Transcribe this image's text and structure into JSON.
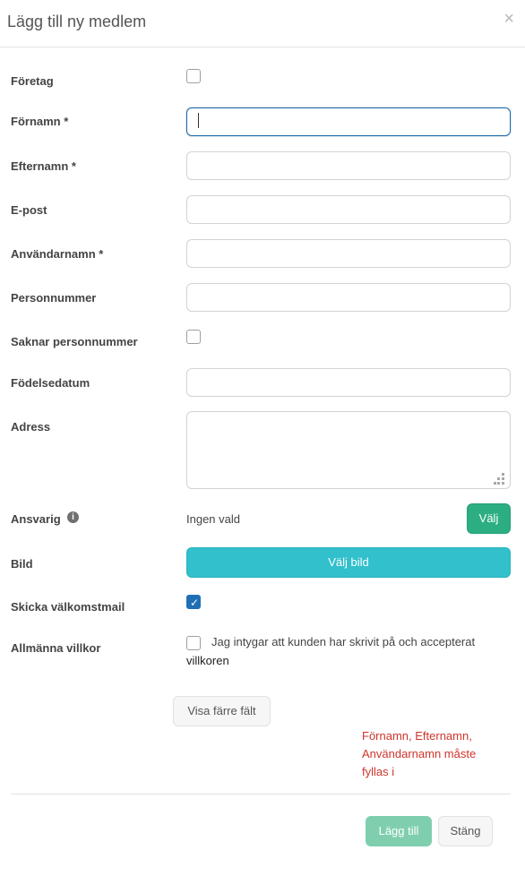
{
  "header": {
    "title": "Lägg till ny medlem",
    "close_glyph": "×"
  },
  "form": {
    "company": {
      "label": "Företag",
      "checked": false
    },
    "first_name": {
      "label": "Förnamn *",
      "value": ""
    },
    "last_name": {
      "label": "Efternamn *",
      "value": ""
    },
    "email": {
      "label": "E-post",
      "value": ""
    },
    "username": {
      "label": "Användarnamn *",
      "value": ""
    },
    "personal_number": {
      "label": "Personnummer",
      "value": ""
    },
    "no_personal_number": {
      "label": "Saknar personnummer",
      "checked": false
    },
    "birth_date": {
      "label": "Födelsedatum",
      "value": ""
    },
    "address": {
      "label": "Adress",
      "value": ""
    },
    "responsible": {
      "label": "Ansvarig",
      "info_icon": "info-circle-icon",
      "value_text": "Ingen vald",
      "choose_button": "Välj"
    },
    "image": {
      "label": "Bild",
      "button": "Välj bild"
    },
    "welcome_mail": {
      "label": "Skicka välkomstmail",
      "checked": true
    },
    "terms": {
      "label": "Allmänna villkor",
      "checked": false,
      "text": "Jag intygar att kunden har skrivit på och accepterat",
      "link": "villkoren"
    }
  },
  "show_fewer_button": "Visa färre fält",
  "error_message": "Förnamn, Efternamn, Användarnamn måste fyllas i",
  "footer": {
    "add_button": "Lägg till",
    "close_button": "Stäng"
  },
  "colors": {
    "primary_green": "#2cae82",
    "teal": "#31c0cc",
    "error_red": "#d0342c",
    "focus_blue": "#1e6aa8",
    "checkbox_blue": "#1f6fb5"
  }
}
